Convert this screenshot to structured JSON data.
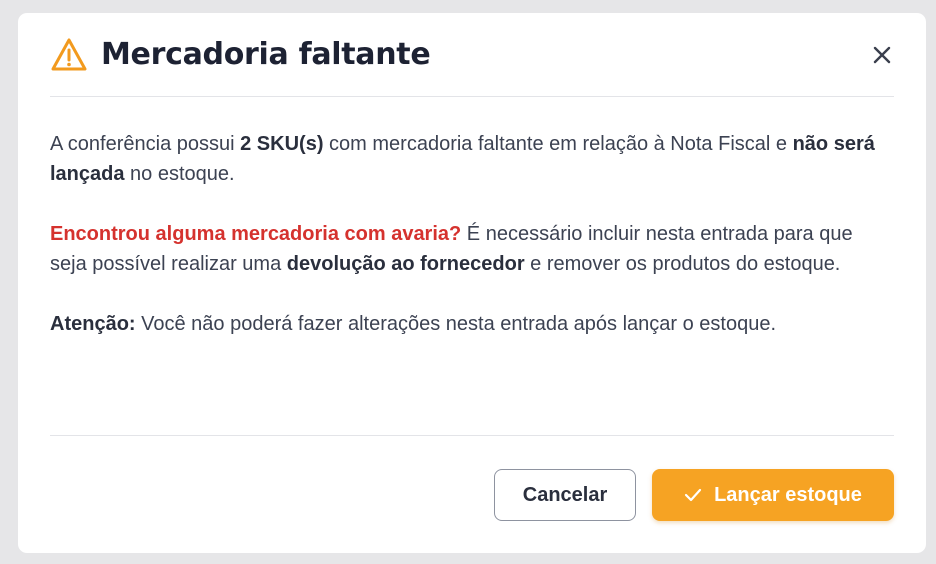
{
  "dialog": {
    "title": "Mercadoria faltante",
    "close_label": "×",
    "paragraph1": {
      "t1": "A conferência possui ",
      "b1": "2 SKU(s)",
      "t2": " com mercadoria faltante em relação à Nota Fiscal e ",
      "b2": "não será lançada",
      "t3": " no estoque."
    },
    "paragraph2": {
      "warning": "Encontrou alguma mercadoria com avaria?",
      "t1": " É necessário incluir nesta entrada para que seja possível realizar uma ",
      "b1": "devolução ao fornecedor",
      "t2": " e remover os produtos do estoque."
    },
    "paragraph3": {
      "b1": "Atenção:",
      "t1": " Você não poderá fazer alterações nesta entrada após lançar o estoque."
    },
    "buttons": {
      "cancel": "Cancelar",
      "confirm": "Lançar estoque"
    }
  },
  "colors": {
    "accent": "#f6a323",
    "warning_icon": "#f29a1e",
    "danger_text": "#d5322e",
    "title": "#1d2233"
  },
  "icons": {
    "header": "warning-triangle-icon",
    "close": "close-icon",
    "confirm": "check-icon"
  }
}
